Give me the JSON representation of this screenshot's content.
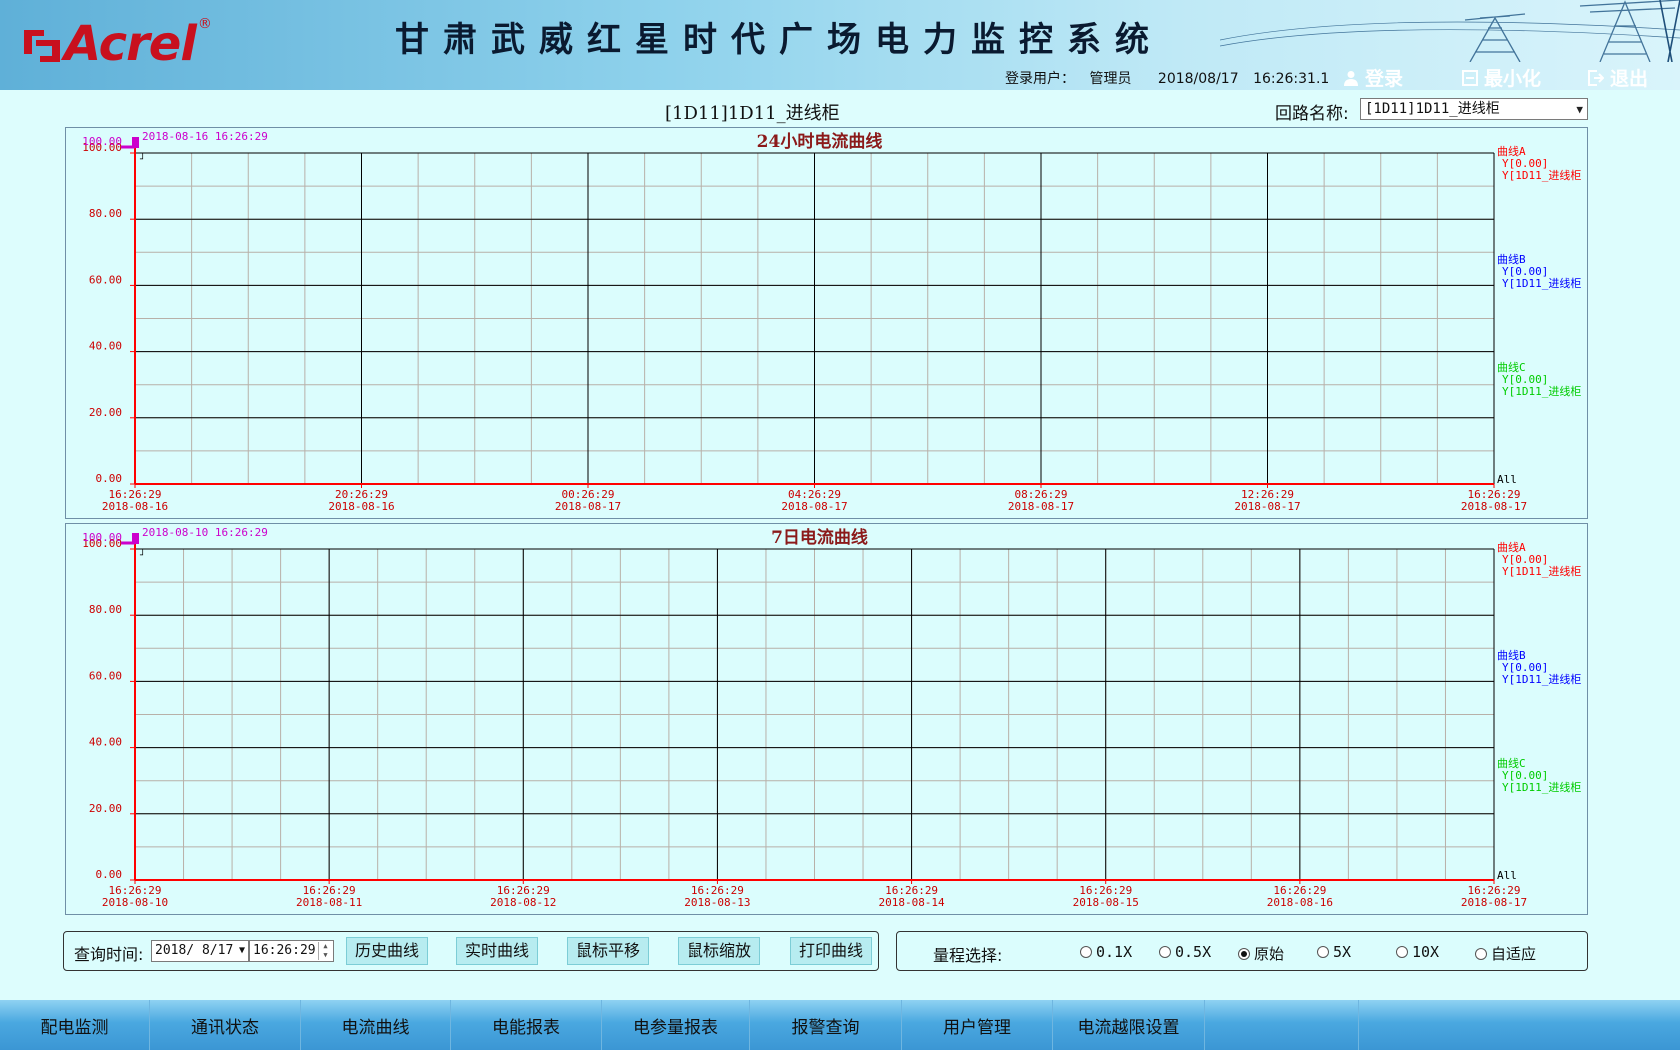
{
  "header": {
    "logo_text": "Acrel",
    "logo_reg": "®",
    "system_title": "甘肃武威红星时代广场电力监控系统",
    "user_label": "登录用户：",
    "user_name": "管理员",
    "date": "2018/08/17",
    "time": "16:26:31.1",
    "login_label": "登录",
    "minimize_label": "最小化",
    "logout_label": "退出"
  },
  "circuit": {
    "title": "[1D11]1D11_进线柜",
    "select_label": "回路名称:",
    "select_value": "[1D11]1D11_进线柜"
  },
  "charts_text": {
    "chart1_title": "24小时电流曲线",
    "chart1_cursor_time": "2018-08-16 16:26:29",
    "chart2_title": "7日电流曲线",
    "chart2_cursor_time": "2018-08-10 16:26:29"
  },
  "chart_data": [
    {
      "type": "line",
      "title": "24小时电流曲线",
      "ylim": [
        0,
        100
      ],
      "y_ticks": [
        "0.00",
        "20.00",
        "40.00",
        "60.00",
        "80.00",
        "100.00"
      ],
      "y_top_label": "100.00",
      "x_ticks": [
        {
          "time": "16:26:29",
          "date": "2018-08-16"
        },
        {
          "time": "20:26:29",
          "date": "2018-08-16"
        },
        {
          "time": "00:26:29",
          "date": "2018-08-17"
        },
        {
          "time": "04:26:29",
          "date": "2018-08-17"
        },
        {
          "time": "08:26:29",
          "date": "2018-08-17"
        },
        {
          "time": "12:26:29",
          "date": "2018-08-17"
        },
        {
          "time": "16:26:29",
          "date": "2018-08-17"
        }
      ],
      "series": [
        {
          "name": "曲线A",
          "value_label": "Y[0.00]",
          "circuit_label": "Y[1D11_进线柜",
          "color": "#ff0000",
          "values": []
        },
        {
          "name": "曲线B",
          "value_label": "Y[0.00]",
          "circuit_label": "Y[1D11_进线柜",
          "color": "#0000ff",
          "values": []
        },
        {
          "name": "曲线C",
          "value_label": "Y[0.00]",
          "circuit_label": "Y[1D11_进线柜",
          "color": "#00cc00",
          "values": []
        }
      ],
      "all_label": "All",
      "grid": true
    },
    {
      "type": "line",
      "title": "7日电流曲线",
      "ylim": [
        0,
        100
      ],
      "y_ticks": [
        "0.00",
        "20.00",
        "40.00",
        "60.00",
        "80.00",
        "100.00"
      ],
      "y_top_label": "100.00",
      "x_ticks": [
        {
          "time": "16:26:29",
          "date": "2018-08-10"
        },
        {
          "time": "16:26:29",
          "date": "2018-08-11"
        },
        {
          "time": "16:26:29",
          "date": "2018-08-12"
        },
        {
          "time": "16:26:29",
          "date": "2018-08-13"
        },
        {
          "time": "16:26:29",
          "date": "2018-08-14"
        },
        {
          "time": "16:26:29",
          "date": "2018-08-15"
        },
        {
          "time": "16:26:29",
          "date": "2018-08-16"
        },
        {
          "time": "16:26:29",
          "date": "2018-08-17"
        }
      ],
      "series": [
        {
          "name": "曲线A",
          "value_label": "Y[0.00]",
          "circuit_label": "Y[1D11_进线柜",
          "color": "#ff0000",
          "values": []
        },
        {
          "name": "曲线B",
          "value_label": "Y[0.00]",
          "circuit_label": "Y[1D11_进线柜",
          "color": "#0000ff",
          "values": []
        },
        {
          "name": "曲线C",
          "value_label": "Y[0.00]",
          "circuit_label": "Y[1D11_进线柜",
          "color": "#00cc00",
          "values": []
        }
      ],
      "all_label": "All",
      "grid": true
    }
  ],
  "query": {
    "label": "查询时间:",
    "date_value": "2018/ 8/17",
    "time_value": "16:26:29",
    "buttons": [
      "历史曲线",
      "实时曲线",
      "鼠标平移",
      "鼠标缩放",
      "打印曲线"
    ]
  },
  "range": {
    "label": "量程选择:",
    "options": [
      "0.1X",
      "0.5X",
      "原始",
      "5X",
      "10X",
      "自适应"
    ],
    "selected": "原始"
  },
  "nav": {
    "items": [
      "配电监测",
      "通讯状态",
      "电流曲线",
      "电能报表",
      "电参量报表",
      "报警查询",
      "用户管理",
      "电流越限设置",
      ""
    ]
  },
  "colors": {
    "axis": "#ff0000",
    "y_tick": "#cc0000",
    "magenta": "#cc00cc",
    "chart_title": "#8b1a1a"
  }
}
